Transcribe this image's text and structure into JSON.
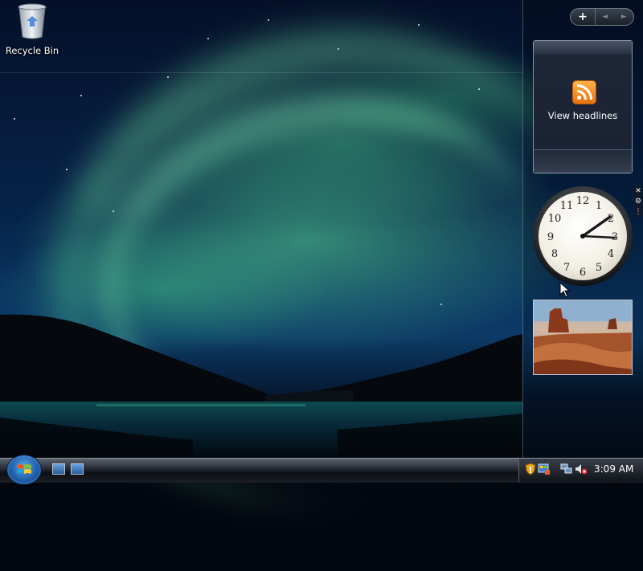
{
  "desktop": {
    "recycle_bin_label": "Recycle Bin"
  },
  "sidebar": {
    "add_button": "+",
    "prev_button": "◄",
    "next_button": "►",
    "feed_gadget": {
      "label": "View headlines"
    },
    "clock_gadget": {
      "numerals": [
        "12",
        "1",
        "2",
        "3",
        "4",
        "5",
        "6",
        "7",
        "8",
        "9",
        "10",
        "11"
      ],
      "time_shown": "3:09"
    },
    "gadget_tools": {
      "close": "✕",
      "options": "🔧",
      "drag": "⋮"
    }
  },
  "taskbar": {
    "clock": "3:09 AM"
  },
  "colors": {
    "feed_accent": "#f28a1e",
    "start_orb": "#1f5ea9",
    "taskbar": "#1b1f26"
  }
}
